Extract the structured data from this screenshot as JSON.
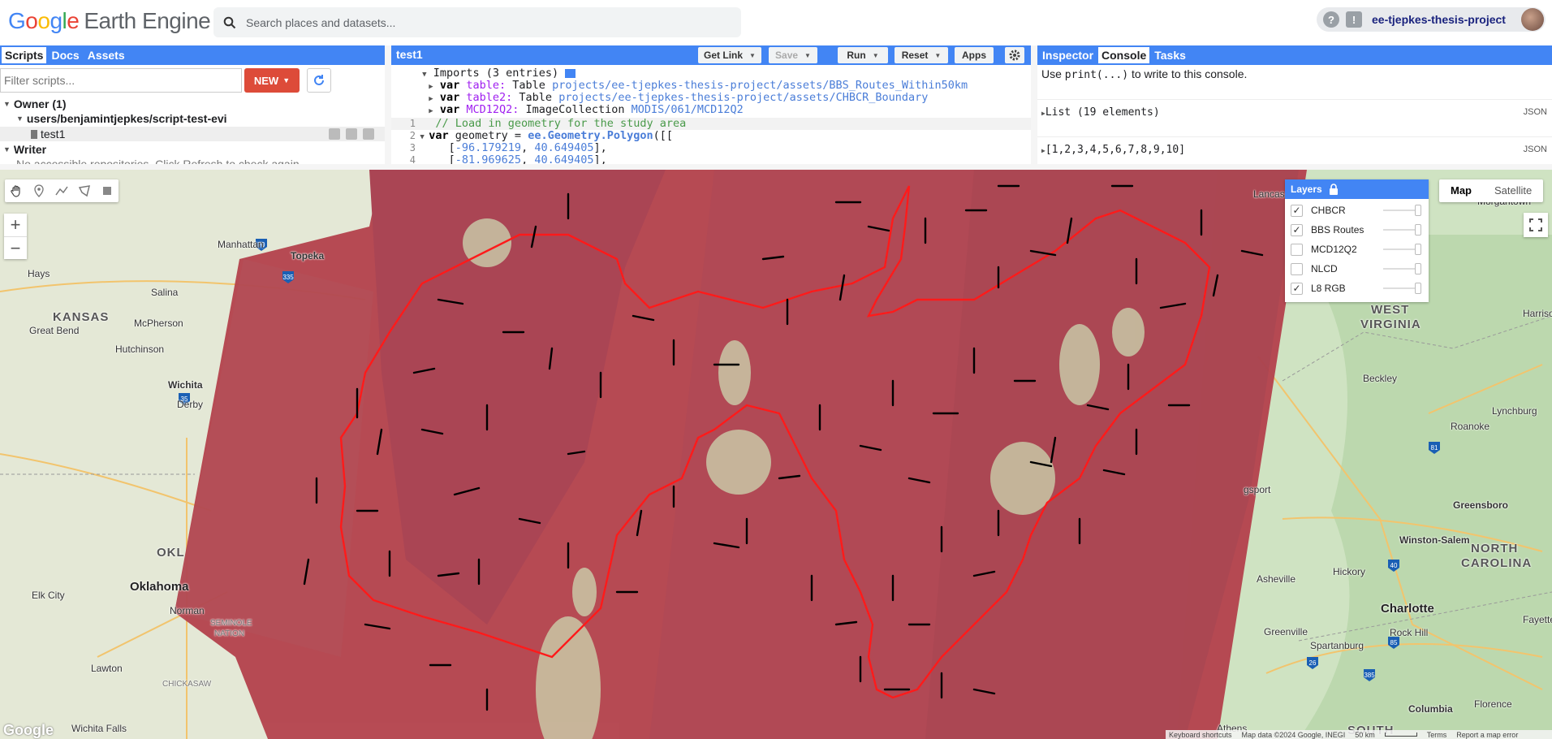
{
  "header": {
    "logo_google": "Google",
    "logo_product": "Earth Engine",
    "search_placeholder": "Search places and datasets...",
    "help_icon": "help-icon",
    "feedback_icon": "feedback-icon",
    "project": "ee-tjepkes-thesis-project"
  },
  "left_panel": {
    "tabs": [
      "Scripts",
      "Docs",
      "Assets"
    ],
    "active_tab": "Scripts",
    "filter_placeholder": "Filter scripts...",
    "new_button": "NEW",
    "tree": {
      "owner": "Owner (1)",
      "repo": "users/benjamintjepkes/script-test-evi",
      "file": "test1",
      "writer": "Writer",
      "writer_note": "No accessible repositories. Click Refresh to check again."
    }
  },
  "editor": {
    "title": "test1",
    "buttons": {
      "get_link": "Get Link",
      "save": "Save",
      "run": "Run",
      "reset": "Reset",
      "apps": "Apps"
    },
    "imports_label": "Imports (3 entries)",
    "imports": [
      {
        "kw": "var",
        "name": "table",
        "type": "Table",
        "path": "projects/ee-tjepkes-thesis-project/assets/BBS_Routes_Within50km"
      },
      {
        "kw": "var",
        "name": "table2",
        "type": "Table",
        "path": "projects/ee-tjepkes-thesis-project/assets/CHBCR_Boundary"
      },
      {
        "kw": "var",
        "name": "MCD12Q2",
        "type": "ImageCollection",
        "path": "MODIS/061/MCD12Q2"
      }
    ],
    "lines": [
      {
        "n": "1",
        "comment": "// Load in geometry for the study area"
      },
      {
        "n": "2",
        "kw": "var",
        "text": " geometry = ",
        "fn": "ee.Geometry.Polygon",
        "tail": "([["
      },
      {
        "n": "3",
        "coord1": "-96.179219",
        "coord2": "40.649405"
      },
      {
        "n": "4",
        "coord1": "-81.969625",
        "coord2": "40.649405"
      }
    ]
  },
  "console": {
    "tabs": [
      "Inspector",
      "Console",
      "Tasks"
    ],
    "active_tab": "Console",
    "hint_pre": "Use ",
    "hint_code": "print(...)",
    "hint_post": " to write to this console.",
    "entries": [
      {
        "text": "List (19 elements)",
        "badge": "JSON"
      },
      {
        "text": "[1,2,3,4,5,6,7,8,9,10]",
        "badge": "JSON"
      }
    ]
  },
  "map": {
    "layers_title": "Layers",
    "layers": [
      {
        "name": "CHBCR",
        "checked": true
      },
      {
        "name": "BBS Routes",
        "checked": true
      },
      {
        "name": "MCD12Q2",
        "checked": false
      },
      {
        "name": "NLCD",
        "checked": false
      },
      {
        "name": "L8 RGB",
        "checked": true
      }
    ],
    "map_types": [
      "Map",
      "Satellite"
    ],
    "active_map_type": "Map",
    "labels": {
      "manhattan": "Manhattan",
      "topeka": "Topeka",
      "hays": "Hays",
      "salina": "Salina",
      "kansas": "KANSAS",
      "mcpherson": "McPherson",
      "great_bend": "Great Bend",
      "hutchinson": "Hutchinson",
      "wichita": "Wichita",
      "derby": "Derby",
      "okl": "OKL",
      "elk_city": "Elk City",
      "oklahoma": "Oklahoma",
      "norman": "Norman",
      "seminole": "SEMINOLE",
      "nation": "NATION",
      "lawton": "Lawton",
      "chickasaw": "CHICKASAW",
      "wichita_falls": "Wichita Falls",
      "lancas": "Lancas",
      "morgantown": "Morgantown",
      "west": "WEST",
      "virginia": "VIRGINIA",
      "harrison": "Harriso",
      "beckley": "Beckley",
      "lynchburg": "Lynchburg",
      "roanoke": "Roanoke",
      "gsport": "gsport",
      "greensboro": "Greensboro",
      "winston_salem": "Winston-Salem",
      "north": "NORTH",
      "carolina": "CAROLINA",
      "asheville": "Asheville",
      "hickory": "Hickory",
      "charlotte": "Charlotte",
      "fayette": "Fayette",
      "greenville": "Greenville",
      "spartanburg": "Spartanburg",
      "rock_hill": "Rock Hill",
      "florence": "Florence",
      "columbia": "Columbia",
      "athens": "Athens",
      "south": "SOUTH",
      "kingsport": "gsport"
    },
    "attribution": {
      "shortcuts": "Keyboard shortcuts",
      "data": "Map data ©2024 Google, INEGI",
      "scale": "50 km",
      "terms": "Terms",
      "report": "Report a map error"
    },
    "watermark": "Google",
    "colors": {
      "imagery": "#b5454f",
      "boundary": "#ff0000",
      "routes": "#000000",
      "accent": "#4285f4"
    }
  }
}
